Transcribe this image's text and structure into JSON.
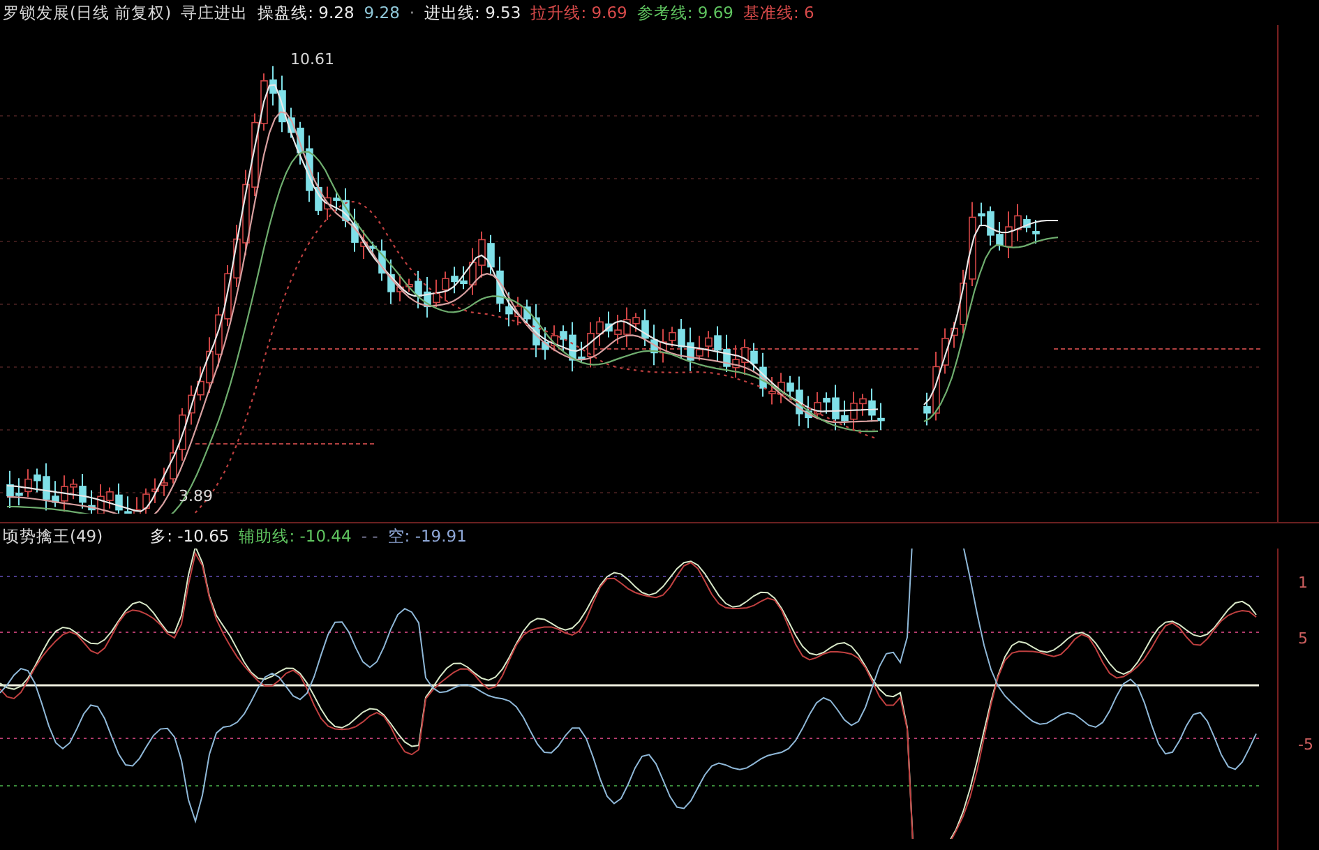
{
  "price_pane": {
    "title": "罗锁发展(日线 前复权)",
    "indicator": "寻庄进出",
    "legend": [
      {
        "text": "操盘线: 9.28",
        "color": "#e8e8e8"
      },
      {
        "text": "9.28",
        "color": "#8fc7d8"
      },
      {
        "text": "进出线: 9.53",
        "color": "#e8e8e8"
      },
      {
        "text": "拉升线: 9.69",
        "color": "#d84a4a"
      },
      {
        "text": "参考线: 9.69",
        "color": "#5fc45f"
      },
      {
        "text": "基准线: 6",
        "color": "#d84a4a"
      }
    ],
    "separator": "·",
    "high_label": "10.61",
    "low_label": "3.89"
  },
  "oscillator_pane": {
    "title": "顷势擒王(49)",
    "legend": [
      {
        "text": "多: -10.65",
        "color": "#e8e8e8"
      },
      {
        "text": "辅助线: -10.44",
        "color": "#5fc45f"
      },
      {
        "text": "-  -",
        "color": "#7a7a9a"
      },
      {
        "text": "空: -19.91",
        "color": "#8fa8d8"
      }
    ],
    "axis_labels": [
      "1",
      "5",
      "-5"
    ]
  }
}
